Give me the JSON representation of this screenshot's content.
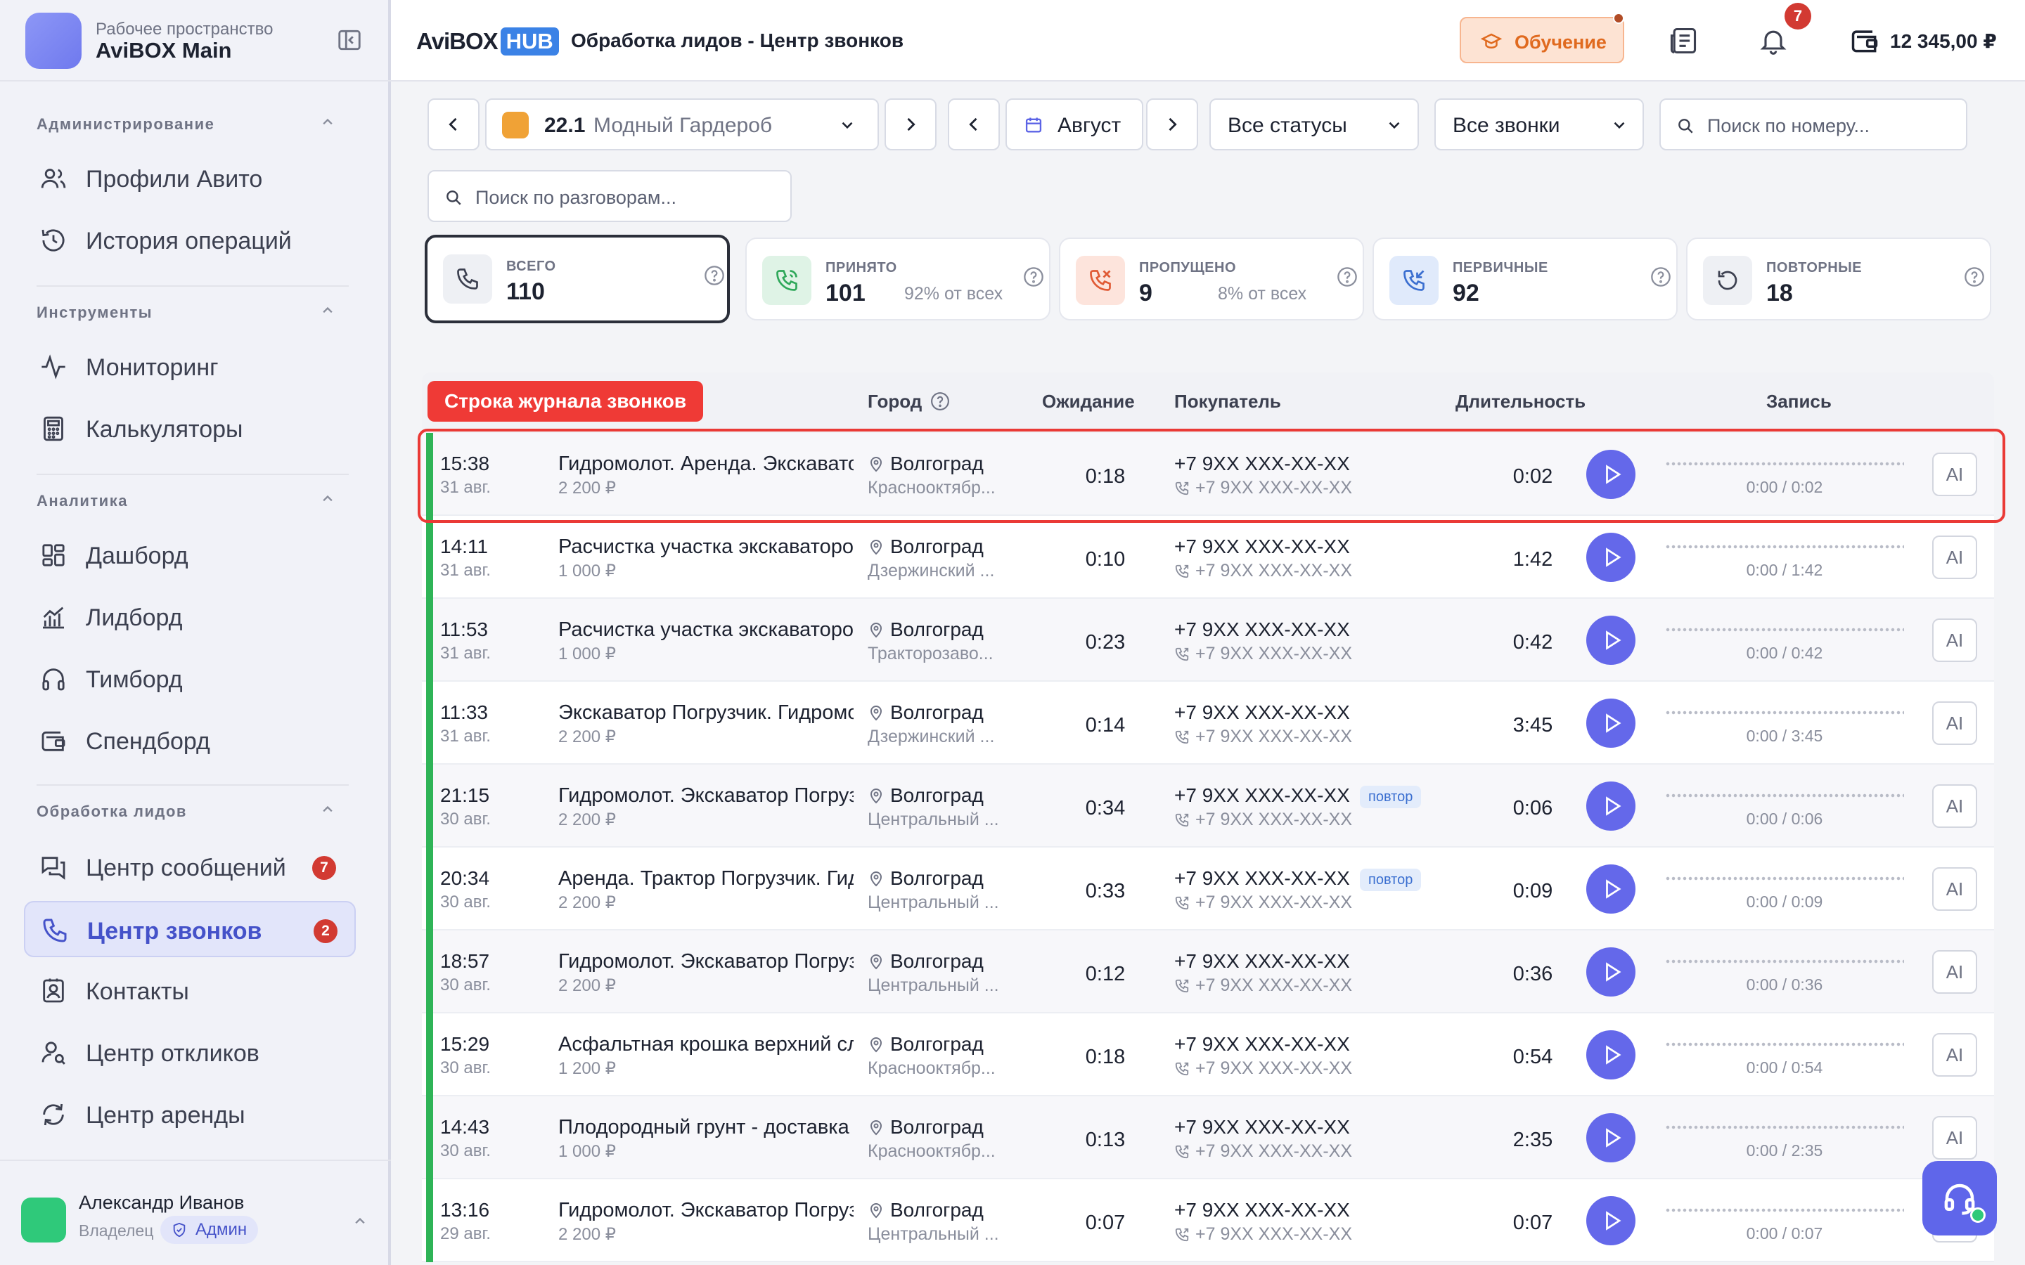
{
  "workspace": {
    "subtitle": "Рабочее пространство",
    "name": "AviBOX Main"
  },
  "sidebar": {
    "sections": [
      {
        "title": "Администрирование",
        "items": [
          {
            "label": "Профили Авито",
            "icon": "users-icon"
          },
          {
            "label": "История операций",
            "icon": "history-icon"
          }
        ]
      },
      {
        "title": "Инструменты",
        "items": [
          {
            "label": "Мониторинг",
            "icon": "pulse-icon"
          },
          {
            "label": "Калькуляторы",
            "icon": "calculator-icon"
          }
        ]
      },
      {
        "title": "Аналитика",
        "items": [
          {
            "label": "Дашборд",
            "icon": "dashboard-icon"
          },
          {
            "label": "Лидборд",
            "icon": "chart-icon"
          },
          {
            "label": "Тимборд",
            "icon": "headphones-icon"
          },
          {
            "label": "Спендборд",
            "icon": "wallet-icon"
          }
        ]
      },
      {
        "title": "Обработка лидов",
        "items": [
          {
            "label": "Центр сообщений",
            "icon": "messages-icon",
            "badge": "7"
          },
          {
            "label": "Центр звонков",
            "icon": "phone-icon",
            "badge": "2",
            "active": true
          },
          {
            "label": "Контакты",
            "icon": "contacts-icon"
          },
          {
            "label": "Центр откликов",
            "icon": "user-search-icon"
          },
          {
            "label": "Центр аренды",
            "icon": "refresh-icon"
          }
        ]
      }
    ]
  },
  "user": {
    "name": "Александр Иванов",
    "role": "Владелец",
    "badge": "Админ"
  },
  "header": {
    "brand_left": "AviBOX",
    "brand_right": "HUB",
    "title": "Обработка лидов - Центр звонков",
    "learn_label": "Обучение",
    "notifications_count": "7",
    "balance": "12 345,00 ₽",
    "accent": "#6468ea"
  },
  "filters": {
    "profile_num": "22.1",
    "profile_name": "Модный Гардероб",
    "month": "Август",
    "status": "Все статусы",
    "calls": "Все звонки",
    "search_number_placeholder": "Поиск по номеру...",
    "search_talks_placeholder": "Поиск по разговорам..."
  },
  "stats": [
    {
      "key": "ВСЕГО",
      "value": "110",
      "pct": "",
      "color": "#eef0f4",
      "stroke": "#3c4050"
    },
    {
      "key": "ПРИНЯТО",
      "value": "101",
      "pct": "92% от всех",
      "color": "#dff3e6",
      "stroke": "#2fa85a"
    },
    {
      "key": "ПРОПУЩЕНО",
      "value": "9",
      "pct": "8% от всех",
      "color": "#fde4dc",
      "stroke": "#e05a35"
    },
    {
      "key": "ПЕРВИЧНЫЕ",
      "value": "92",
      "pct": "",
      "color": "#e0eafb",
      "stroke": "#3b6fd0"
    },
    {
      "key": "ПОВТОРНЫЕ",
      "value": "18",
      "pct": "",
      "color": "#eef0f4",
      "stroke": "#3c4050"
    }
  ],
  "table": {
    "tooltip": "Строка журнала звонков",
    "headers": {
      "city": "Город",
      "wait": "Ожидание",
      "buyer": "Покупатель",
      "duration": "Длительность",
      "record": "Запись"
    },
    "ai_label": "AI",
    "repeat_label": "повтор",
    "rows": [
      {
        "time": "15:38",
        "date": "31 авг.",
        "title": "Гидромолот. Аренда. Экскаватор Погрузчик",
        "price": "2 200 ₽",
        "city": "Волгоград",
        "district": "Краснооктябр...",
        "wait": "0:18",
        "phone": "+7 9XX XXX-XX-XX",
        "phone2": "+7 9XX XXX-XX-XX",
        "repeat": false,
        "duration": "0:02",
        "progress": "0:00 / 0:02"
      },
      {
        "time": "14:11",
        "date": "31 авг.",
        "title": "Расчистка участка экскаватором",
        "price": "1 000 ₽",
        "city": "Волгоград",
        "district": "Дзержинский ...",
        "wait": "0:10",
        "phone": "+7 9XX XXX-XX-XX",
        "phone2": "+7 9XX XXX-XX-XX",
        "repeat": false,
        "duration": "1:42",
        "progress": "0:00 / 1:42"
      },
      {
        "time": "11:53",
        "date": "31 авг.",
        "title": "Расчистка участка экскаватором",
        "price": "1 000 ₽",
        "city": "Волгоград",
        "district": "Тракторозаво...",
        "wait": "0:23",
        "phone": "+7 9XX XXX-XX-XX",
        "phone2": "+7 9XX XXX-XX-XX",
        "repeat": false,
        "duration": "0:42",
        "progress": "0:00 / 0:42"
      },
      {
        "time": "11:33",
        "date": "31 авг.",
        "title": "Экскаватор Погрузчик. Гидромолот",
        "price": "2 200 ₽",
        "city": "Волгоград",
        "district": "Дзержинский ...",
        "wait": "0:14",
        "phone": "+7 9XX XXX-XX-XX",
        "phone2": "+7 9XX XXX-XX-XX",
        "repeat": false,
        "duration": "3:45",
        "progress": "0:00 / 3:45"
      },
      {
        "time": "21:15",
        "date": "30 авг.",
        "title": "Гидромолот. Экскаватор Погрузчик",
        "price": "2 200 ₽",
        "city": "Волгоград",
        "district": "Центральный ...",
        "wait": "0:34",
        "phone": "+7 9XX XXX-XX-XX",
        "phone2": "+7 9XX XXX-XX-XX",
        "repeat": true,
        "duration": "0:06",
        "progress": "0:00 / 0:06"
      },
      {
        "time": "20:34",
        "date": "30 авг.",
        "title": "Аренда. Трактор Погрузчик. Гидромолот",
        "price": "2 200 ₽",
        "city": "Волгоград",
        "district": "Центральный ...",
        "wait": "0:33",
        "phone": "+7 9XX XXX-XX-XX",
        "phone2": "+7 9XX XXX-XX-XX",
        "repeat": true,
        "duration": "0:09",
        "progress": "0:00 / 0:09"
      },
      {
        "time": "18:57",
        "date": "30 авг.",
        "title": "Гидромолот. Экскаватор Погрузчик",
        "price": "2 200 ₽",
        "city": "Волгоград",
        "district": "Центральный ...",
        "wait": "0:12",
        "phone": "+7 9XX XXX-XX-XX",
        "phone2": "+7 9XX XXX-XX-XX",
        "repeat": false,
        "duration": "0:36",
        "progress": "0:00 / 0:36"
      },
      {
        "time": "15:29",
        "date": "30 авг.",
        "title": "Асфальтная крошка верхний слой",
        "price": "1 200 ₽",
        "city": "Волгоград",
        "district": "Краснооктябр...",
        "wait": "0:18",
        "phone": "+7 9XX XXX-XX-XX",
        "phone2": "+7 9XX XXX-XX-XX",
        "repeat": false,
        "duration": "0:54",
        "progress": "0:00 / 0:54"
      },
      {
        "time": "14:43",
        "date": "30 авг.",
        "title": "Плодородный грунт - доставка",
        "price": "1 000 ₽",
        "city": "Волгоград",
        "district": "Краснооктябр...",
        "wait": "0:13",
        "phone": "+7 9XX XXX-XX-XX",
        "phone2": "+7 9XX XXX-XX-XX",
        "repeat": false,
        "duration": "2:35",
        "progress": "0:00 / 2:35"
      },
      {
        "time": "13:16",
        "date": "29 авг.",
        "title": "Гидромолот. Экскаватор Погрузчик",
        "price": "2 200 ₽",
        "city": "Волгоград",
        "district": "Центральный ...",
        "wait": "0:07",
        "phone": "+7 9XX XXX-XX-XX",
        "phone2": "+7 9XX XXX-XX-XX",
        "repeat": false,
        "duration": "0:07",
        "progress": "0:00 / 0:07"
      }
    ]
  }
}
